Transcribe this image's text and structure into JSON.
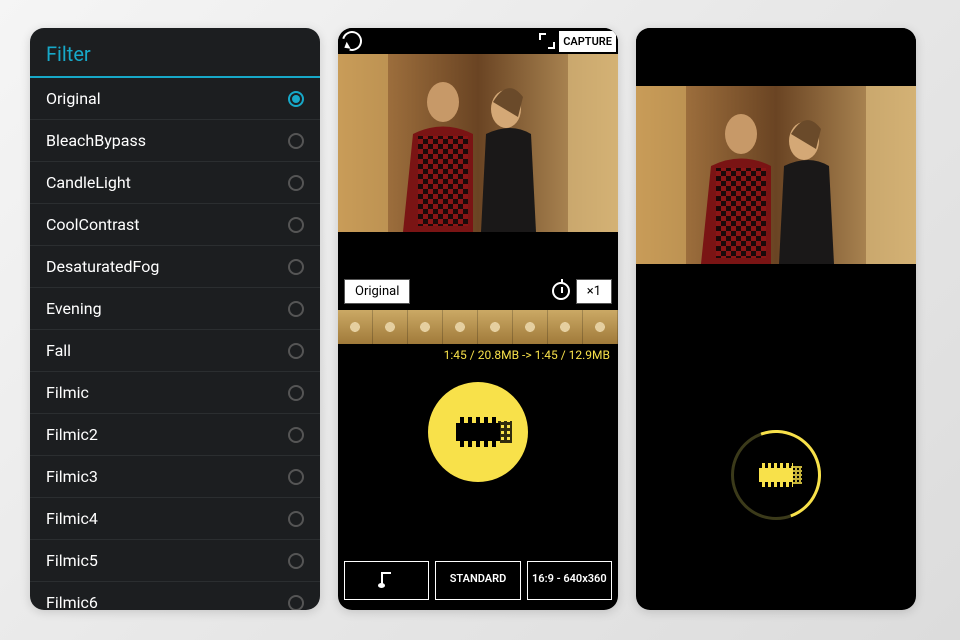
{
  "filters_panel": {
    "title": "Filter",
    "items": [
      {
        "label": "Original",
        "selected": true
      },
      {
        "label": "BleachBypass",
        "selected": false
      },
      {
        "label": "CandleLight",
        "selected": false
      },
      {
        "label": "CoolContrast",
        "selected": false
      },
      {
        "label": "DesaturatedFog",
        "selected": false
      },
      {
        "label": "Evening",
        "selected": false
      },
      {
        "label": "Fall",
        "selected": false
      },
      {
        "label": "Filmic",
        "selected": false
      },
      {
        "label": "Filmic2",
        "selected": false
      },
      {
        "label": "Filmic3",
        "selected": false
      },
      {
        "label": "Filmic4",
        "selected": false
      },
      {
        "label": "Filmic5",
        "selected": false
      },
      {
        "label": "Filmic6",
        "selected": false
      }
    ]
  },
  "capture_panel": {
    "capture_label": "CAPTURE",
    "current_filter": "Original",
    "speed": "×1",
    "info": "1:45 / 20.8MB -> 1:45 / 12.9MB",
    "music_label": "",
    "quality_label": "STANDARD",
    "resolution_label": "16:9 - 640x360"
  }
}
